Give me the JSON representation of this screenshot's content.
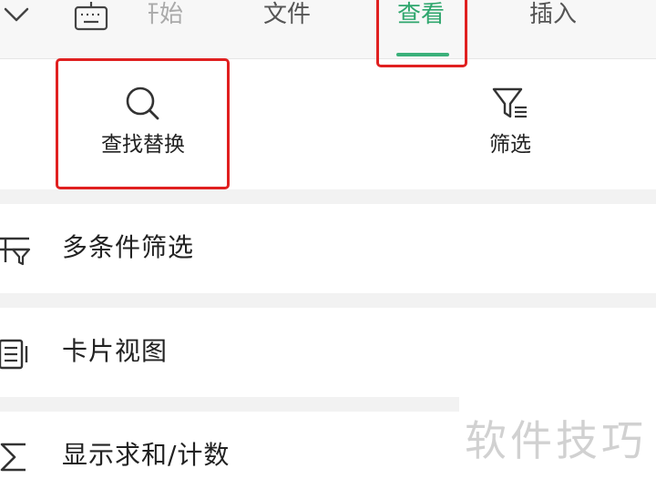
{
  "tabs": [
    {
      "label": "开始",
      "state": "partially-hidden"
    },
    {
      "label": "文件",
      "state": "normal"
    },
    {
      "label": "查看",
      "state": "active"
    },
    {
      "label": "插入",
      "state": "normal"
    }
  ],
  "tools": {
    "find_replace": {
      "label": "查找替换",
      "icon": "search-icon"
    },
    "filter": {
      "label": "筛选",
      "icon": "filter-icon"
    }
  },
  "menu": [
    {
      "label": "多条件筛选",
      "icon": "multi-filter-icon"
    },
    {
      "label": "卡片视图",
      "icon": "card-view-icon"
    },
    {
      "label": "显示求和/计数",
      "icon": "sigma-icon"
    }
  ],
  "watermark": "软件技巧",
  "colors": {
    "accent": "#2ea66d",
    "highlight": "#e02020",
    "separator": "#f2f2f2"
  }
}
